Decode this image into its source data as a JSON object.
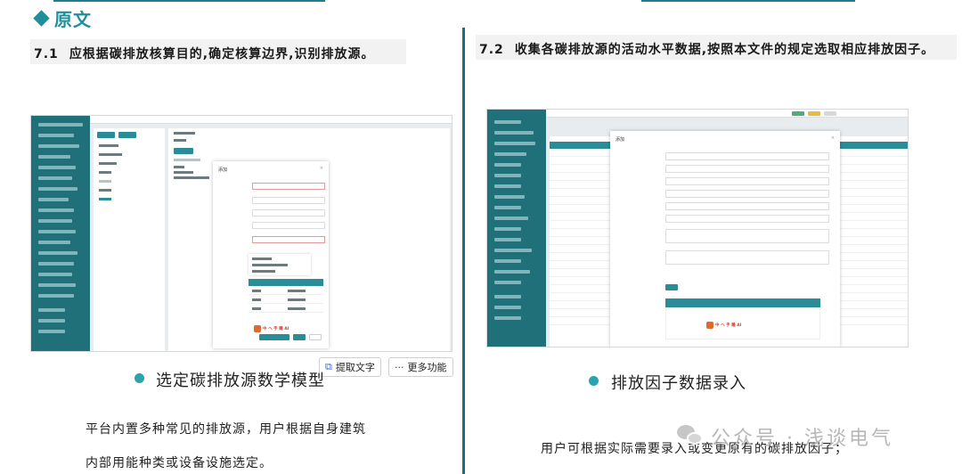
{
  "section": {
    "title": "原文"
  },
  "left": {
    "clause_num": "7.1",
    "clause_text": "应根据碳排放核算目的,确定核算边界,识别排放源。",
    "caption": "选定碳排放源数学模型",
    "body_line1": "平台内置多种常见的排放源，用户根据自身建筑",
    "body_line2": "内部用能种类或设备设施选定。"
  },
  "right": {
    "clause_num": "7.2",
    "clause_text": "收集各碳排放源的活动水平数据,按照本文件的规定选取相应排放因子。",
    "caption": "排放因子数据录入",
    "body": "用户可根据实际需要录入或变更原有的碳排放因子；"
  },
  "toolbar": {
    "extract_label": "提取文字",
    "extract_icon": "text-extract-icon",
    "more_label": "更多功能",
    "more_icon": "ellipsis-icon"
  },
  "screens": {
    "left_modal_title": "添加",
    "right_modal_title": "添加",
    "brand_text": "中 ヘ 手 雕 AI"
  },
  "watermark": {
    "text": "公众号 · 浅谈电气",
    "icon": "wechat-icon"
  },
  "colors": {
    "accent": "#1f8f9b",
    "sidebar": "#20707a",
    "divider": "#1e6f7a"
  }
}
